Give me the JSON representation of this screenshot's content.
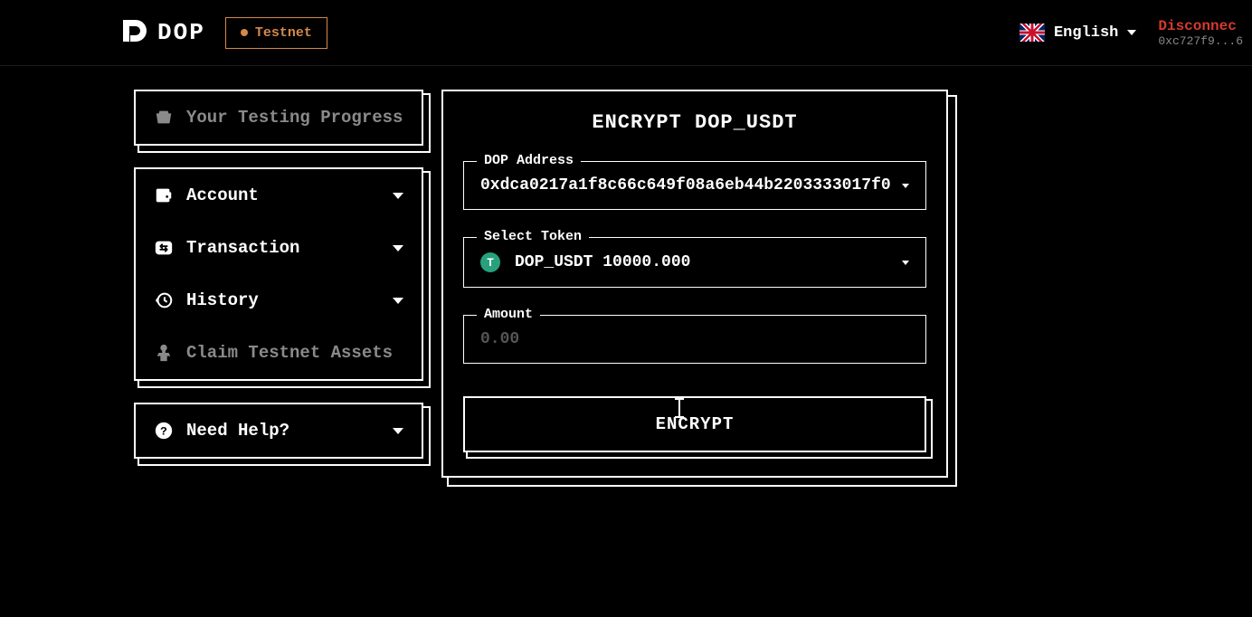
{
  "header": {
    "logo_text": "DOP",
    "testnet_label": "Testnet",
    "language": "English",
    "wallet_status": "Disconnec",
    "wallet_address": "0xc727f9...6"
  },
  "sidebar": {
    "progress_label": "Your Testing Progress",
    "account_label": "Account",
    "transaction_label": "Transaction",
    "history_label": "History",
    "claim_label": "Claim Testnet Assets",
    "help_label": "Need Help?"
  },
  "main": {
    "title": "ENCRYPT DOP_USDT",
    "address_legend": "DOP Address",
    "address_value": "0xdca0217a1f8c66c649f08a6eb44b2203333017f0",
    "token_legend": "Select Token",
    "token_badge": "T",
    "token_value": "DOP_USDT 10000.000",
    "amount_legend": "Amount",
    "amount_placeholder": "0.00",
    "encrypt_button": "ENCRYPT"
  }
}
